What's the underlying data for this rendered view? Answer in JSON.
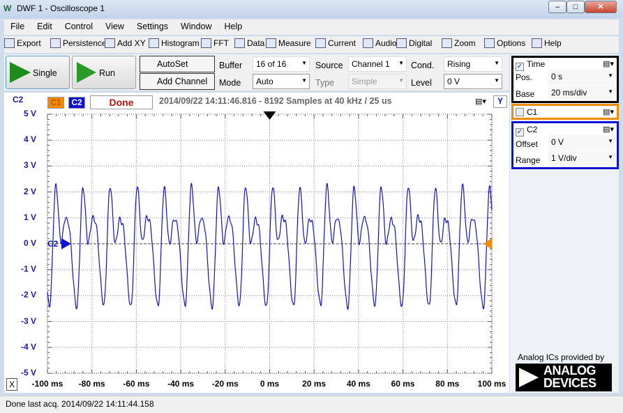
{
  "window": {
    "title": "DWF 1 - Oscilloscope 1",
    "buttons": [
      "minimize",
      "maximize",
      "close"
    ]
  },
  "menu": [
    "File",
    "Edit",
    "Control",
    "View",
    "Settings",
    "Window",
    "Help"
  ],
  "toolbar": [
    {
      "label": "Export",
      "icon": "export-icon"
    },
    {
      "label": "Persistence",
      "icon": "persistence-icon"
    },
    {
      "label": "Add XY",
      "icon": "xy-icon"
    },
    {
      "label": "Histogram",
      "icon": "histogram-icon"
    },
    {
      "label": "FFT",
      "icon": "fft-icon"
    },
    {
      "label": "Data",
      "icon": "table-icon"
    },
    {
      "label": "Measure",
      "icon": "ruler-icon"
    },
    {
      "label": "Current",
      "icon": "flag-icon"
    },
    {
      "label": "Audio",
      "icon": "speaker-icon"
    },
    {
      "label": "Digital",
      "icon": "binary-icon"
    },
    {
      "label": "Zoom",
      "icon": "magnifier-icon"
    },
    {
      "label": "Options",
      "icon": "options-icon"
    },
    {
      "label": "Help",
      "icon": "help-icon"
    }
  ],
  "controls": {
    "single": "Single",
    "run": "Run",
    "autoset": "AutoSet",
    "add_channel": "Add Channel",
    "buffer_label": "Buffer",
    "buffer_value": "16 of 16",
    "mode_label": "Mode",
    "mode_value": "Auto",
    "source_label": "Source",
    "source_value": "Channel 1",
    "type_label": "Type",
    "type_value": "Simple",
    "cond_label": "Cond.",
    "cond_value": "Rising",
    "level_label": "Level",
    "level_value": "0 V"
  },
  "plot": {
    "channel_label": "C2",
    "c1_tab": "C1",
    "c2_tab": "C2",
    "status": "Done",
    "info": "2014/09/22  14:11:46.816 - 8192 Samples at 40 kHz / 25 us",
    "y_button": "Y",
    "x_button": "X",
    "marker_label": "C2"
  },
  "right": {
    "time": {
      "title": "Time",
      "checked": true,
      "pos_label": "Pos.",
      "pos_value": "0 s",
      "base_label": "Base",
      "base_value": "20 ms/div"
    },
    "c1": {
      "title": "C1",
      "checked": false
    },
    "c2": {
      "title": "C2",
      "checked": true,
      "offset_label": "Offset",
      "offset_value": "0 V",
      "range_label": "Range",
      "range_value": "1 V/div"
    },
    "provided_by": "Analog ICs provided by",
    "logo": "ANALOG DEVICES"
  },
  "statusbar": "Done last acq. 2014/09/22  14:11:44.158",
  "colors": {
    "c1": "#f08a00",
    "c2": "#1010d0",
    "status_done": "#c01010",
    "time_panel": "#000000"
  },
  "chart_data": {
    "type": "line",
    "xlim": [
      -100,
      100
    ],
    "ylim": [
      -5,
      5
    ],
    "grid": true,
    "x_ticks": [
      "-100 ms",
      "-80 ms",
      "-60 ms",
      "-40 ms",
      "-20 ms",
      "0 ms",
      "20 ms",
      "40 ms",
      "60 ms",
      "80 ms",
      "100 ms"
    ],
    "y_ticks": [
      "5 V",
      "4 V",
      "3 V",
      "2 V",
      "1 V",
      "0 V",
      "-1 V",
      "-2 V",
      "-3 V",
      "-4 V",
      "-5 V"
    ],
    "series": [
      {
        "name": "C2",
        "color": "#1010d0",
        "period_ms": 12.2,
        "max_v": 2.3,
        "min_v": -2.6,
        "secondary_peak_v": 1.0
      }
    ]
  }
}
